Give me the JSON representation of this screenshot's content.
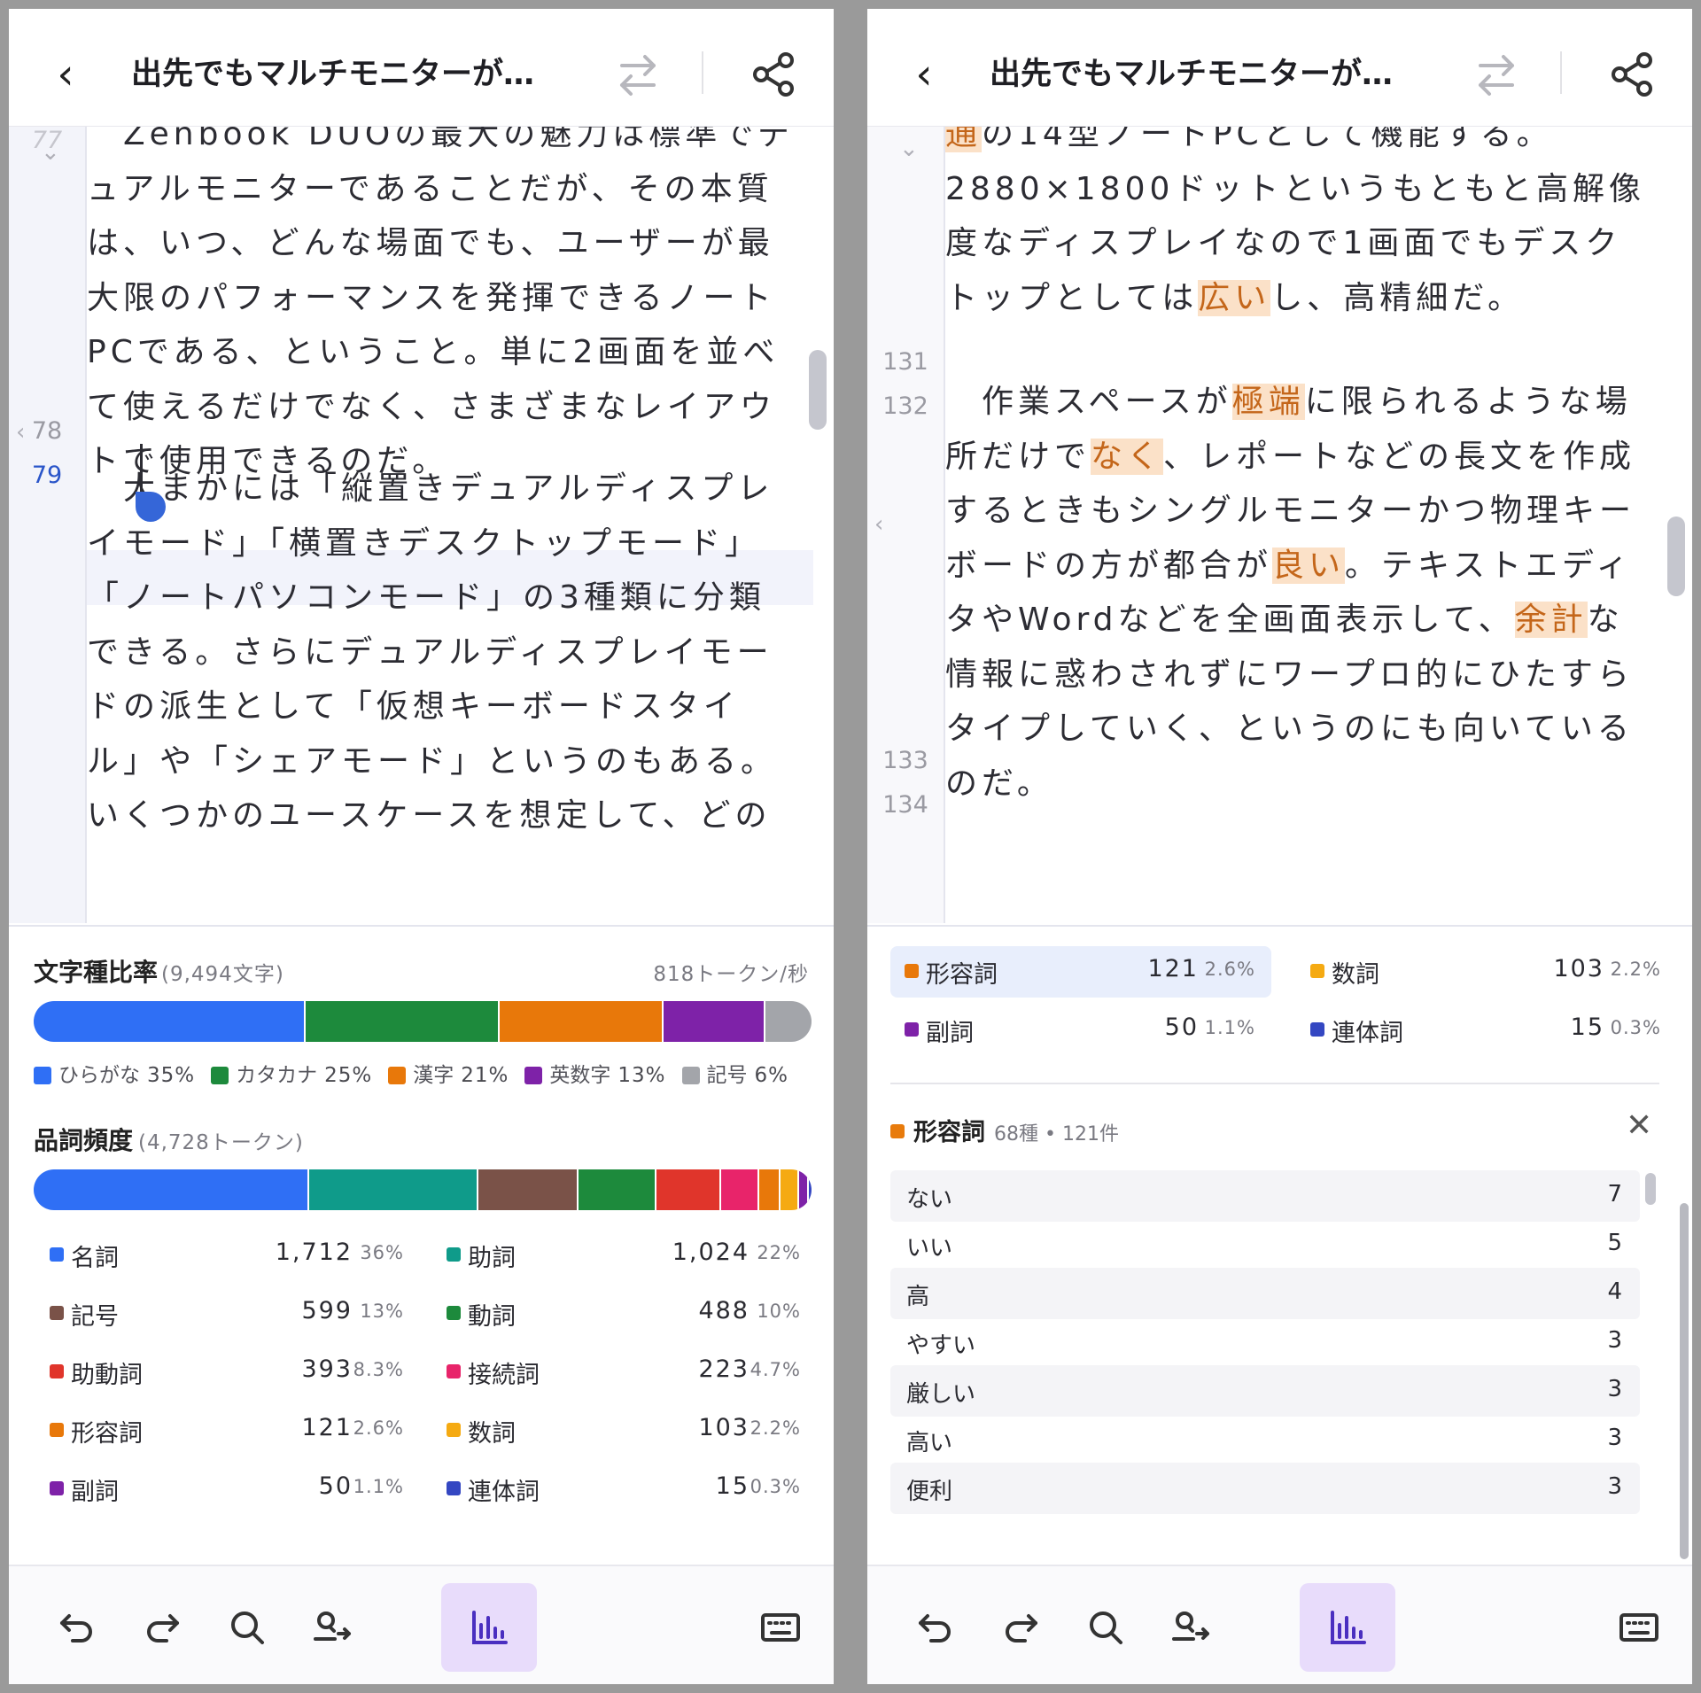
{
  "left": {
    "header": {
      "title": "出先でもマルチモニターが…"
    },
    "editor": {
      "line_numbers": [
        "77",
        "78",
        "79"
      ],
      "para77": "　Zenbook DUOの最大の魅力は標準でデュアルモニターであることだが、その本質は、いつ、どんな場面でも、ユーザーが最大限のパフォーマンスを発揮できるノートPCである、ということ。単に2画面を並べて使えるだけでなく、さまざまなレイアウトで使用できるのだ。",
      "para79": "　大まかには「縦置きデュアルディスプレイモード」「横置きデスクトップモード」「ノートパソコンモード」の3種類に分類できる。さらにデュアルディスプレイモードの派生として「仮想キーボードスタイル」や「シェアモード」というのもある。いくつかのユースケースを想定して、どの"
    },
    "char_ratio": {
      "title": "文字種比率",
      "subtitle": "(9,494文字)",
      "rate": "818トークン/秒",
      "segments": [
        {
          "label": "ひらがな",
          "pct": "35%",
          "value": 35,
          "color": "#2f6ff5"
        },
        {
          "label": "カタカナ",
          "pct": "25%",
          "value": 25,
          "color": "#1d8a3c"
        },
        {
          "label": "漢字",
          "pct": "21%",
          "value": 21,
          "color": "#e8780a"
        },
        {
          "label": "英数字",
          "pct": "13%",
          "value": 13,
          "color": "#7e22a8"
        },
        {
          "label": "記号",
          "pct": "6%",
          "value": 6,
          "color": "#a3a5aa"
        }
      ]
    },
    "pos_freq": {
      "title": "品詞頻度",
      "subtitle": "(4,728トークン)",
      "bar": [
        {
          "value": 36,
          "color": "#2f6ff5"
        },
        {
          "value": 22,
          "color": "#0f9b8a"
        },
        {
          "value": 13,
          "color": "#7a5248"
        },
        {
          "value": 10,
          "color": "#1d8a3c"
        },
        {
          "value": 8.3,
          "color": "#e0352b"
        },
        {
          "value": 4.7,
          "color": "#e8246a"
        },
        {
          "value": 2.6,
          "color": "#e8780a"
        },
        {
          "value": 2.2,
          "color": "#f5aa12"
        },
        {
          "value": 1.1,
          "color": "#7e22a8"
        },
        {
          "value": 0.3,
          "color": "#3447c2"
        }
      ],
      "rows": [
        {
          "name": "名詞",
          "count": "1,712",
          "pct": "36%",
          "color": "#2f6ff5"
        },
        {
          "name": "助詞",
          "count": "1,024",
          "pct": "22%",
          "color": "#0f9b8a"
        },
        {
          "name": "記号",
          "count": "599",
          "pct": "13%",
          "color": "#7a5248"
        },
        {
          "name": "動詞",
          "count": "488",
          "pct": "10%",
          "color": "#1d8a3c"
        },
        {
          "name": "助動詞",
          "count": "393",
          "pct": "8.3%",
          "color": "#e0352b"
        },
        {
          "name": "接続詞",
          "count": "223",
          "pct": "4.7%",
          "color": "#e8246a"
        },
        {
          "name": "形容詞",
          "count": "121",
          "pct": "2.6%",
          "color": "#e8780a"
        },
        {
          "name": "数詞",
          "count": "103",
          "pct": "2.2%",
          "color": "#f5aa12"
        },
        {
          "name": "副詞",
          "count": "50",
          "pct": "1.1%",
          "color": "#7e22a8"
        },
        {
          "name": "連体詞",
          "count": "15",
          "pct": "0.3%",
          "color": "#3447c2"
        }
      ]
    }
  },
  "right": {
    "header": {
      "title": "出先でもマルチモニターが…"
    },
    "editor": {
      "line_numbers": [
        "131",
        "132",
        "133",
        "134"
      ],
      "para_top_hl": "通",
      "para_top_a": "の14型ノートPCとして機能する。2880×1800ドットというもともと高解像度なディスプレイなので1画面でもデスクトップとしては",
      "para_top_hl2": "広い",
      "para_top_b": "し、高精細だ。",
      "p132_a": "　作業スペースが",
      "p132_h1": "極端",
      "p132_b": "に限られるような場所だけで",
      "p132_h2": "なく",
      "p132_c": "、レポートなどの長文を作成するときもシングルモニターかつ物理キーボードの方が都合が",
      "p132_h3": "良い",
      "p132_d": "。テキストエディタやWordなどを全画面表示して、",
      "p132_h4": "余計",
      "p132_e": "な情報に惑わされずにワープロ的にひたすらタイプしていく、というのにも向いているのだ。"
    },
    "pos_rows": [
      {
        "name": "形容詞",
        "count": "121",
        "pct": "2.6%",
        "color": "#e8780a",
        "selected": true
      },
      {
        "name": "数詞",
        "count": "103",
        "pct": "2.2%",
        "color": "#f5aa12"
      },
      {
        "name": "副詞",
        "count": "50",
        "pct": "1.1%",
        "color": "#7e22a8"
      },
      {
        "name": "連体詞",
        "count": "15",
        "pct": "0.3%",
        "color": "#3447c2"
      }
    ],
    "detail": {
      "title": "形容詞",
      "meta": "68種 • 121件",
      "words": [
        {
          "word": "ない",
          "count": "7"
        },
        {
          "word": "いい",
          "count": "5"
        },
        {
          "word": "高",
          "count": "4"
        },
        {
          "word": "やすい",
          "count": "3"
        },
        {
          "word": "厳しい",
          "count": "3"
        },
        {
          "word": "高い",
          "count": "3"
        },
        {
          "word": "便利",
          "count": "3"
        }
      ]
    }
  },
  "toolbar": {
    "icons": [
      "undo-icon",
      "redo-icon",
      "search-icon",
      "replace-icon",
      "stats-icon",
      "keyboard-icon"
    ],
    "active": "stats-icon"
  }
}
